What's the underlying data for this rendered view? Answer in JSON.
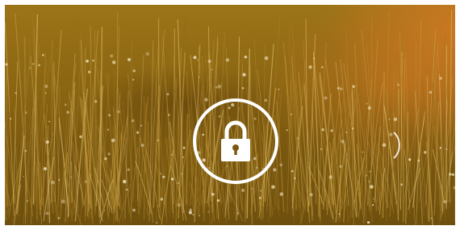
{
  "lock_screen": {
    "wallpaper": "grass-field",
    "unlock_icon": "padlock-icon",
    "ring_color": "#ffffff",
    "swipe_hint_icon": "arc-hint-icon"
  }
}
